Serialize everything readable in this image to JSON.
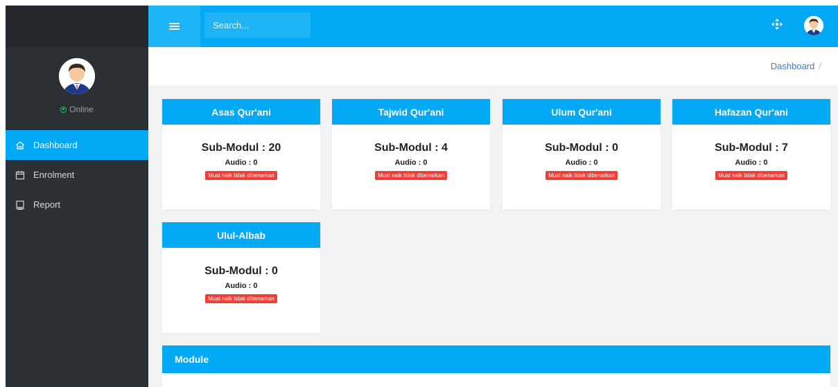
{
  "sidebar": {
    "status": "Online",
    "items": [
      {
        "label": "Dashboard",
        "icon": "home-icon",
        "active": true
      },
      {
        "label": "Enrolment",
        "icon": "calendar-icon",
        "active": false
      },
      {
        "label": "Report",
        "icon": "report-icon",
        "active": false
      }
    ]
  },
  "topbar": {
    "menu_icon": "hamburger-icon",
    "search_placeholder": "Search...",
    "move_icon": "move-icon",
    "accent": "#03a9f4"
  },
  "breadcrumb": {
    "current": "Dashboard",
    "separator": "/"
  },
  "cards": [
    {
      "title": "Asas Qur'ani",
      "sub_modul": "Sub-Modul : 20",
      "audio": "Audio : 0",
      "badge": "Muat naik tidak dibenarkan"
    },
    {
      "title": "Tajwid Qur'ani",
      "sub_modul": "Sub-Modul : 4",
      "audio": "Audio : 0",
      "badge": "Muat naik tidak dibenarkan"
    },
    {
      "title": "Ulum Qur'ani",
      "sub_modul": "Sub-Modul : 0",
      "audio": "Audio : 0",
      "badge": "Muat naik tidak dibenarkan"
    },
    {
      "title": "Hafazan Qur'ani",
      "sub_modul": "Sub-Modul : 7",
      "audio": "Audio : 0",
      "badge": "Muat naik tidak dibenarkan"
    },
    {
      "title": "Ulul-Albab",
      "sub_modul": "Sub-Modul : 0",
      "audio": "Audio : 0",
      "badge": "Muat naik tidak dibenarkan"
    }
  ],
  "module": {
    "title": "Module"
  },
  "colors": {
    "sidebar_bg": "#2b3035",
    "badge_red": "#ef3e36"
  }
}
